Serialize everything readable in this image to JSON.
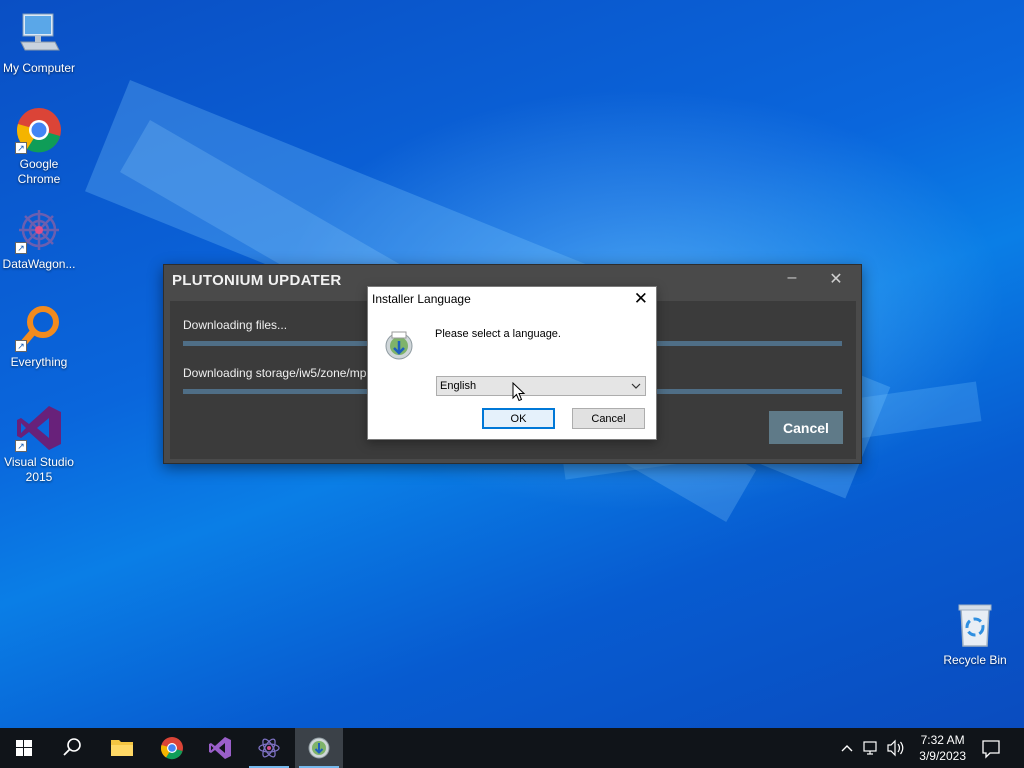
{
  "desktop": {
    "icons": [
      {
        "label": "My Computer",
        "icon": "computer-icon"
      },
      {
        "label": "Google Chrome",
        "icon": "chrome-icon"
      },
      {
        "label": "DataWagon...",
        "icon": "datawagon-icon"
      },
      {
        "label": "Everything",
        "icon": "search-magnifier-icon"
      },
      {
        "label": "Visual Studio 2015",
        "icon": "visual-studio-icon"
      },
      {
        "label": "Recycle Bin",
        "icon": "recycle-bin-icon"
      }
    ]
  },
  "plutonium": {
    "title": "PLUTONIUM UPDATER",
    "status1": "Downloading files...",
    "status2": "Downloading storage/iw5/zone/mp",
    "progress1": 0,
    "progress2": 0,
    "cancel_label": "Cancel"
  },
  "installer": {
    "title": "Installer Language",
    "message": "Please select a language.",
    "selected_language": "English",
    "ok_label": "OK",
    "cancel_label": "Cancel"
  },
  "taskbar": {
    "time": "7:32 AM",
    "date": "3/9/2023"
  },
  "colors": {
    "taskbar": "#101419",
    "accent": "#0078d7",
    "plutonium_button": "#5f7a88"
  }
}
